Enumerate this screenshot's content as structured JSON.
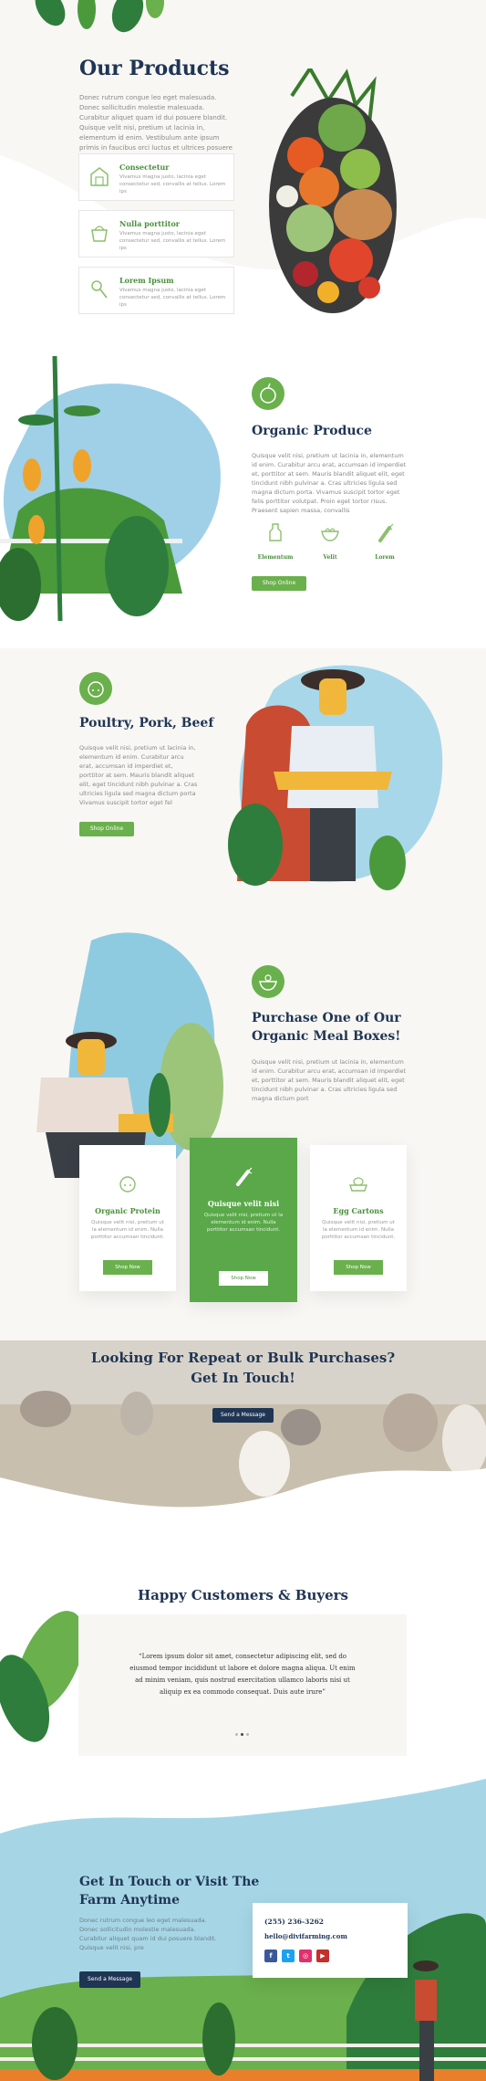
{
  "products": {
    "title": "Our Products",
    "intro": "Donec rutrum congue leo eget malesuada. Donec sollicitudin molestie malesuada. Curabitur aliquet quam id dui posuere blandit. Quisque velit nisi, pretium ut lacinia in, elementum id enim. Vestibulum ante ipsum primis in faucibus orci luctus et ultrices posuere",
    "cards": [
      {
        "title": "Consectetur",
        "desc": "Vivamus magna justo, lacinia eget consectetur sed, convallis at tellus. Lorem ips"
      },
      {
        "title": "Nulla porttitor",
        "desc": "Vivamus magna justo, lacinia eget consectetur sed, convallis at tellus. Lorem ips"
      },
      {
        "title": "Lorem Ipsum",
        "desc": "Vivamus magna justo, lacinia eget consectetur sed, convallis at tellus. Lorem ips"
      }
    ]
  },
  "produce": {
    "title": "Organic Produce",
    "text": "Quisque velit nisi, pretium ut lacinia in, elementum id enim. Curabitur arcu erat, accumsan id imperdiet et, porttitor at sem. Mauris blandit aliquet elit, eget tincidunt nibh pulvinar a. Cras ultricies ligula sed magna dictum porta. Vivamus suscipit tortor eget felis porttitor volutpat. Proin eget tortor risus. Praesent sapien massa, convallis",
    "items": [
      {
        "label": "Elementum"
      },
      {
        "label": "Velit"
      },
      {
        "label": "Lorem"
      }
    ],
    "button": "Shop Online"
  },
  "poultry": {
    "title": "Poultry, Pork, Beef",
    "text": "Quisque velit nisi, pretium ut lacinia in, elementum id enim. Curabitur arcu erat, accumsan id imperdiet et, porttitor at sem. Mauris blandit aliquet elit, eget tincidunt nibh pulvinar a. Cras ultricies ligula sed magna dictum porta Vivamus suscipit tortor eget fel",
    "button": "Shop Online"
  },
  "mealboxes": {
    "title_line1": "Purchase One of Our",
    "title_line2": "Organic Meal Boxes!",
    "text": "Quisque velit nisi, pretium ut lacinia in, elementum id enim. Curabitur arcu erat, accumsan id imperdiet et, porttitor at sem. Mauris blandit aliquet elit, eget tincidunt nibh pulvinar a. Cras ultricies ligula sed magna dictum port",
    "boxes": [
      {
        "title": "Organic Protein",
        "desc": "Quisque velit nisi, pretium ut la elementum id enim. Nulla porttitor accumsan tincidunt.",
        "button": "Shop Now"
      },
      {
        "title": "Quisque velit nisi",
        "desc": "Quisque velit nisi, pretium ut la elementum id enim. Nulla porttitor accumsan tincidunt.",
        "button": "Shop Now"
      },
      {
        "title": "Egg Cartons",
        "desc": "Quisque velit nisi, pretium ut la elementum id enim. Nulla porttitor accumsan tincidunt.",
        "button": "Shop Now"
      }
    ]
  },
  "bulk": {
    "line1": "Looking For Repeat or Bulk Purchases?",
    "line2": "Get In Touch!",
    "button": "Send a Message"
  },
  "testimonials": {
    "title": "Happy Customers & Buyers",
    "quote": "“Lorem ipsum dolor sit amet, consectetur adipiscing elit, sed do eiusmod tempor incididunt ut labore et dolore magna aliqua. Ut enim ad minim veniam, quis nostrud exercitation ullamco laboris nisi ut aliquip ex ea commodo consequat. Duis aute irure”"
  },
  "contact": {
    "title_line1": "Get In Touch or Visit The",
    "title_line2": "Farm Anytime",
    "text": "Donec rutrum congue leo eget malesuada. Donec sollicitudin molestie malesuada. Curabitur aliquet quam id dui posuere blandit. Quisque velit nisi, pre",
    "button": "Send a Message",
    "phone": "(255) 236-3262",
    "email": "hello@divifarming.com",
    "socials": [
      {
        "icon": "facebook-icon",
        "glyph": "f",
        "color": "#3b5998"
      },
      {
        "icon": "twitter-icon",
        "glyph": "t",
        "color": "#1da1f2"
      },
      {
        "icon": "instagram-icon",
        "glyph": "◎",
        "color": "#e1306c"
      },
      {
        "icon": "youtube-icon",
        "glyph": "▶",
        "color": "#c4302b"
      }
    ]
  },
  "colors": {
    "accent_green": "#6ab04c",
    "heading_navy": "#1f3554",
    "button_navy": "#1f3554"
  }
}
